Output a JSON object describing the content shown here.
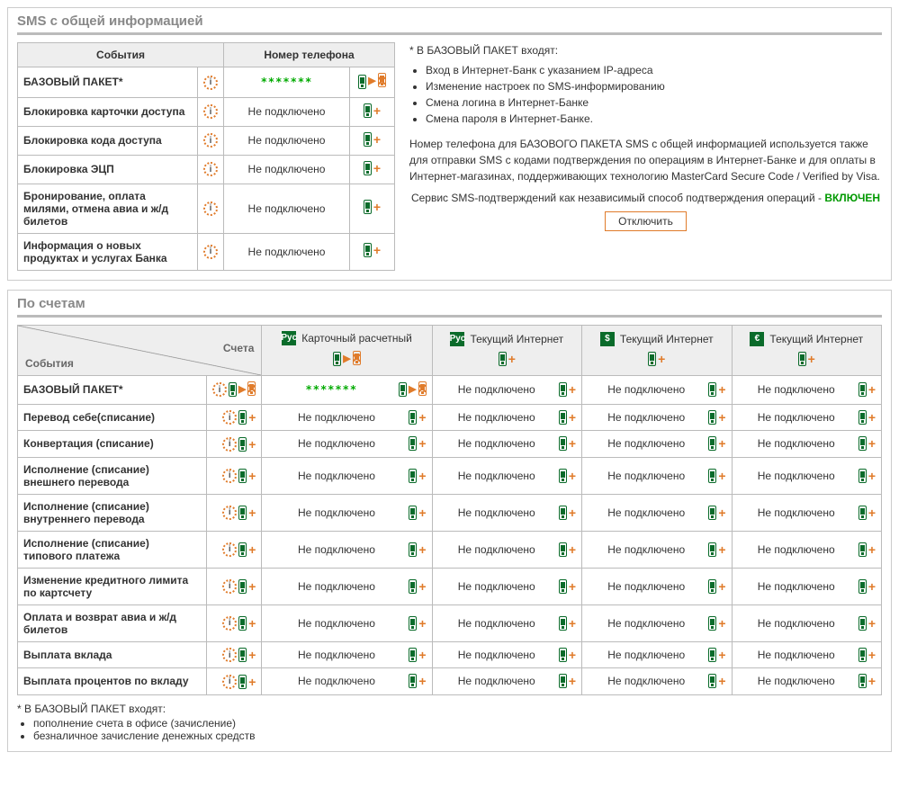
{
  "section1": {
    "title": "SMS с общей информацией",
    "col_events": "События",
    "col_phone": "Номер телефона",
    "connected_mask": "*******",
    "not_connected": "Не подключено",
    "rows": [
      {
        "label": "БАЗОВЫЙ ПАКЕТ*",
        "connected": true
      },
      {
        "label": "Блокировка карточки доступа",
        "connected": false
      },
      {
        "label": "Блокировка кода доступа",
        "connected": false
      },
      {
        "label": "Блокировка ЭЦП",
        "connected": false
      },
      {
        "label": "Бронирование, оплата милями, отмена авиа и ж/д билетов",
        "connected": false
      },
      {
        "label": "Информация о новых продуктах и услугах Банка",
        "connected": false
      }
    ],
    "info": {
      "intro": "* В БАЗОВЫЙ ПАКЕТ входят:",
      "bullets": [
        "Вход в Интернет-Банк с указанием IP-адреса",
        "Изменение настроек по SMS-информированию",
        "Смена логина в Интернет-Банке",
        "Смена пароля в Интернет-Банке."
      ],
      "para": "Номер телефона для БАЗОВОГО ПАКЕТА SMS с общей информацией используется также для отправки SMS с кодами подтверждения по операциям в Интернет-Банке и для оплаты в Интернет-магазинах, поддерживающих технологию MasterCard Secure Code / Verified by Visa.",
      "service_prefix": "Сервис SMS-подтверждений как независимый способ подтверждения операций - ",
      "service_status": "ВКЛЮЧЕН",
      "disable_btn": "Отключить"
    }
  },
  "section2": {
    "title": "По счетам",
    "diag_accounts": "Счета",
    "diag_events": "События",
    "connected_mask": "*******",
    "not_connected": "Не подключено",
    "accounts": [
      {
        "icon": "Pyc",
        "name": "Карточный расчетный"
      },
      {
        "icon": "Pyc",
        "name": "Текущий Интернет"
      },
      {
        "icon": "$",
        "name": "Текущий Интернет"
      },
      {
        "icon": "€",
        "name": "Текущий Интернет"
      }
    ],
    "events": [
      "БАЗОВЫЙ ПАКЕТ*",
      "Перевод себе(списание)",
      "Конвертация (списание)",
      "Исполнение (списание) внешнего перевода",
      "Исполнение (списание) внутреннего перевода",
      "Исполнение (списание) типового платежа",
      "Изменение кредитного лимита по картсчету",
      "Оплата и возврат авиа и ж/д билетов",
      "Выплата вклада",
      "Выплата процентов по вкладу"
    ],
    "matrix": [
      [
        true,
        false,
        false,
        false
      ],
      [
        false,
        false,
        false,
        false
      ],
      [
        false,
        false,
        false,
        false
      ],
      [
        false,
        false,
        false,
        false
      ],
      [
        false,
        false,
        false,
        false
      ],
      [
        false,
        false,
        false,
        false
      ],
      [
        false,
        false,
        false,
        false
      ],
      [
        false,
        false,
        false,
        false
      ],
      [
        false,
        false,
        false,
        false
      ],
      [
        false,
        false,
        false,
        false
      ]
    ]
  },
  "footnote": {
    "intro": "* В БАЗОВЫЙ ПАКЕТ входят:",
    "bullets": [
      "пополнение счета в офисе (зачисление)",
      "безналичное зачисление денежных средств"
    ]
  }
}
